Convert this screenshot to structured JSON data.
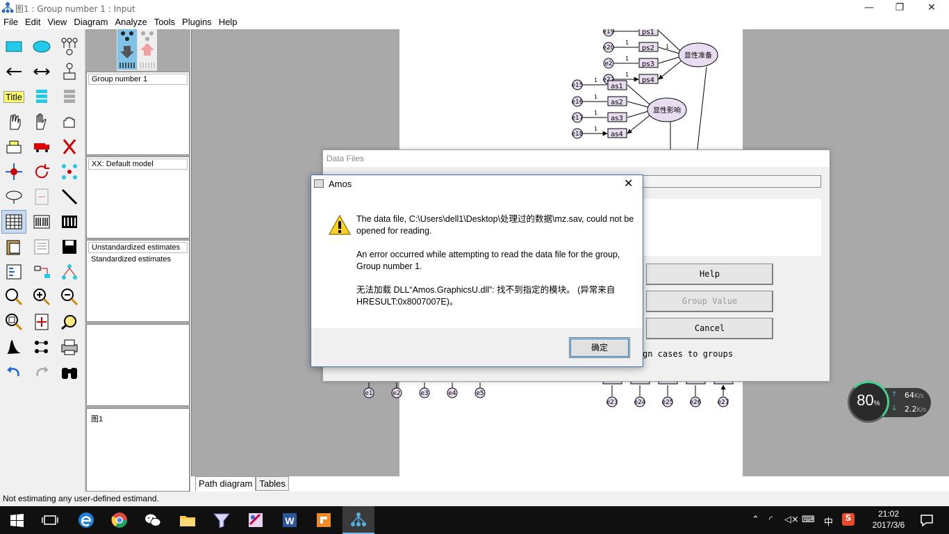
{
  "window": {
    "title": "图1 : Group number 1 : Input"
  },
  "menu": [
    "File",
    "Edit",
    "View",
    "Diagram",
    "Analyze",
    "Tools",
    "Plugins",
    "Help"
  ],
  "tools": {
    "title_label": "Title",
    "items": [
      "rectangle",
      "ellipse",
      "indicator",
      "single-arrow",
      "double-arrow",
      "unique-variable",
      "title",
      "list-variables-model",
      "list-variables-data",
      "select-one",
      "select-all",
      "deselect-all",
      "duplicate",
      "move",
      "erase",
      "move-parameters",
      "rotate",
      "reflect",
      "shape",
      "touch-up",
      "preserve-symmetries",
      "data-files",
      "analysis-properties",
      "calculate-estimates",
      "copy-clipboard",
      "text-output",
      "save",
      "variable-names",
      "object-properties",
      "drag-properties",
      "zoom-in-area",
      "zoom-in",
      "zoom-out",
      "zoom-page",
      "fit-page",
      "loupe",
      "bayesian",
      "multiple-group",
      "print",
      "undo",
      "redo",
      "specification-search"
    ]
  },
  "panels": {
    "groups": {
      "header": "Group number 1"
    },
    "models": {
      "header": "XX: Default model"
    },
    "estimates": {
      "items": [
        "Unstandardized estimates",
        "Standardized estimates"
      ]
    },
    "files": {
      "item": "图1"
    }
  },
  "diagram": {
    "top_group": {
      "latent": "显性准备",
      "indicators": [
        "ps1",
        "ps2",
        "ps3",
        "ps4"
      ],
      "errors": [
        "e19",
        "e20",
        "e2",
        "e22"
      ]
    },
    "second_group": {
      "latent": "显性影响",
      "indicators": [
        "as1",
        "as2",
        "as3",
        "as4"
      ],
      "errors": [
        "e15",
        "e16",
        "e17",
        "e18"
      ]
    },
    "bottom_left_errors": [
      "e1",
      "e2",
      "e3",
      "e4",
      "e5"
    ],
    "bottom_right_errors": [
      "e23",
      "e24",
      "e25",
      "e26",
      "e27"
    ],
    "path_label": "1"
  },
  "tabs": [
    {
      "label": "Path diagram",
      "active": true
    },
    {
      "label": "Tables",
      "active": false
    }
  ],
  "status_bar": "Not estimating any user-defined estimand.",
  "data_files_dialog": {
    "title": "Data Files",
    "buttons": {
      "help": "Help",
      "group_value": "Group Value",
      "cancel": "Cancel"
    },
    "assign_text": "gn cases to groups"
  },
  "message_box": {
    "title": "Amos",
    "line1": "The data file, C:\\Users\\dell1\\Desktop\\处理过的数据\\mz.sav, could not be opened for reading.",
    "line2": "An error occurred while attempting to read the data file for the group, Group number 1.",
    "line3": "无法加载 DLL“Amos.GraphicsU.dll”: 找不到指定的模块。 (异常来自 HRESULT:0x8007007E)。",
    "ok_label": "确定"
  },
  "network_widget": {
    "percent": "80",
    "percent_unit": "%",
    "upload": "64",
    "download": "2.2",
    "unit": "K/s"
  },
  "taskbar": {
    "time": "21:02",
    "date": "2017/3/6",
    "ime": "中",
    "apps": [
      "start",
      "task-view",
      "edge",
      "chrome",
      "wechat",
      "file-explorer",
      "app-filter",
      "app-paint",
      "word",
      "pdf-editor",
      "amos"
    ]
  },
  "colors": {
    "accent": "#0078d7",
    "latent_fill": "#e8dcf0",
    "indicator_fill": "#e8dcf0",
    "taskbar": "#101010"
  }
}
